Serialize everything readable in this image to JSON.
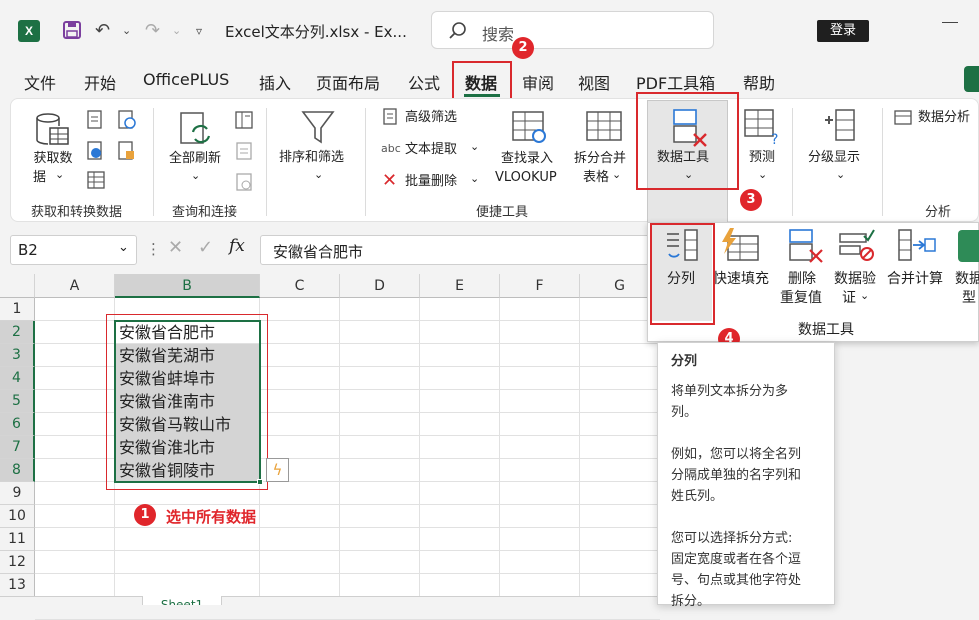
{
  "app": {
    "icon_letter": "X",
    "file_title": "Excel文本分列.xlsx  -  Ex...",
    "search_placeholder": "搜索",
    "login_label": "登录"
  },
  "menu": [
    "文件",
    "开始",
    "OfficePLUS",
    "插入",
    "页面布局",
    "公式",
    "数据",
    "审阅",
    "视图",
    "PDF工具箱",
    "帮助"
  ],
  "ribbon": {
    "get_data_l1": "获取数",
    "get_data_l2": "据",
    "refresh_l1": "全部刷新",
    "sort_filter": "排序和筛选",
    "advanced_filter": "高级筛选",
    "text_extract": "文本提取",
    "batch_delete": "批量删除",
    "lookup_l1": "查找录入",
    "lookup_l2": "VLOOKUP",
    "split_merge_l1": "拆分合并",
    "split_merge_l2": "表格",
    "data_tools": "数据工具",
    "forecast": "预测",
    "outline": "分级显示",
    "analysis_cut": "数据分析",
    "groups": {
      "get_transform": "获取和转换数据",
      "query_conn": "查询和连接",
      "quick_tools": "便捷工具",
      "analysis": "分析"
    }
  },
  "formula_bar": {
    "cell_ref": "B2",
    "fx": "fx",
    "content": "安徽省合肥市"
  },
  "sheet": {
    "columns": [
      "A",
      "B",
      "C",
      "D",
      "E",
      "F",
      "G"
    ],
    "rows": [
      "1",
      "2",
      "3",
      "4",
      "5",
      "6",
      "7",
      "8",
      "9",
      "10",
      "11",
      "12",
      "13"
    ],
    "b_values": [
      "安徽省合肥市",
      "安徽省芜湖市",
      "安徽省蚌埠市",
      "安徽省淮南市",
      "安徽省马鞍山市",
      "安徽省淮北市",
      "安徽省铜陵市"
    ],
    "tab_name": "Sheet1"
  },
  "dropdown": {
    "items": [
      {
        "l1": "分列",
        "l2": ""
      },
      {
        "l1": "快速填充",
        "l2": ""
      },
      {
        "l1": "删除",
        "l2": "重复值"
      },
      {
        "l1": "数据验",
        "l2": "证"
      },
      {
        "l1": "合并计算",
        "l2": ""
      },
      {
        "l1": "数据",
        "l2": "型"
      }
    ],
    "group_label": "数据工具"
  },
  "tooltip": {
    "title": "分列",
    "lines": [
      "将单列文本拆分为多",
      "列。",
      "",
      "例如，您可以将全名列",
      "分隔成单独的名字列和",
      "姓氏列。",
      "",
      "您可以选择拆分方式:",
      "固定宽度或者在各个逗",
      "号、句点或其他字符处",
      "拆分。"
    ]
  },
  "annotations": {
    "step1": "1",
    "step1_text": "选中所有数据",
    "step2": "2",
    "step3": "3",
    "step4": "4"
  },
  "colors": {
    "accent_green": "#1d7044",
    "annotation_red": "#d9292d",
    "selection_fill": "#d4d4d4"
  }
}
